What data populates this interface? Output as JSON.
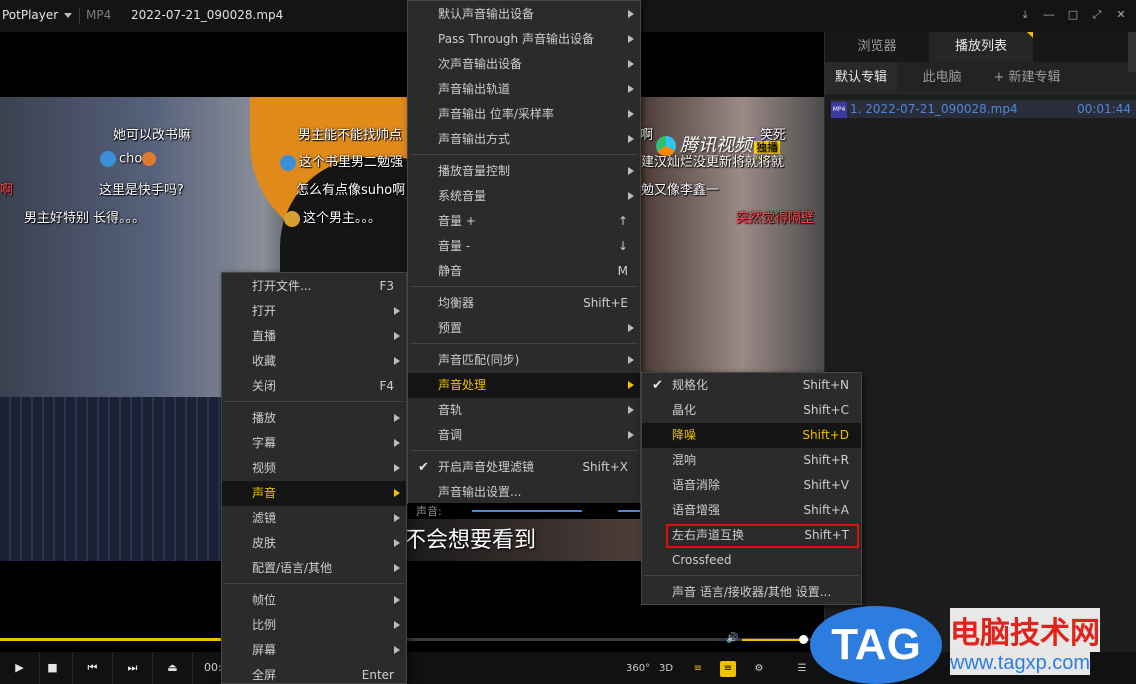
{
  "titlebar": {
    "app": "PotPlayer",
    "format": "MP4",
    "filename": "2022-07-21_090028.mp4",
    "buttons": [
      "pin-icon",
      "minimize-icon",
      "maximize-icon",
      "fullscreen-icon",
      "close-icon"
    ]
  },
  "danmaku": [
    {
      "text": "她可以改书嘛"
    },
    {
      "text": "男主能不能找帅点"
    },
    {
      "text": "cho"
    },
    {
      "text": "这个书里男二勉强"
    },
    {
      "text": "这里是快手吗?"
    },
    {
      "text": "怎么有点像suho啊"
    },
    {
      "text": "男主好特别 长得。。。"
    },
    {
      "text": "这个男主。。。"
    },
    {
      "text": "啊"
    },
    {
      "text": "笑死"
    },
    {
      "text": "建汉灿烂没更新将就将就"
    },
    {
      "text": "勉又像李鑫一"
    },
    {
      "text": "突然觉得隔壁"
    },
    {
      "text": "啊"
    }
  ],
  "video": {
    "watermark_text": "腾讯视频",
    "watermark_tag": "独播",
    "subtitle": "不会想要看到"
  },
  "panel": {
    "tabs": [
      "浏览器",
      "播放列表"
    ],
    "subtabs": [
      "默认专辑",
      "此电脑",
      "+ 新建专辑"
    ],
    "items": [
      {
        "label": "1. 2022-07-21_090028.mp4",
        "duration": "00:01:44",
        "icon": "mp4-file-icon"
      }
    ]
  },
  "controls": {
    "time": "00:",
    "icons": [
      "play-icon",
      "stop-icon",
      "prev-icon",
      "next-icon",
      "eject-icon"
    ],
    "right_icons": [
      "360-icon",
      "3d-icon",
      "playlist-search-icon",
      "subtitle-icon",
      "settings-icon",
      "menu-icon"
    ],
    "label_360": "360°",
    "label_3d": "3D",
    "volume_pct": 92,
    "seek_pct": 27
  },
  "menu1": {
    "items": [
      {
        "label": "打开文件...",
        "shortcut": "F3"
      },
      {
        "label": "打开",
        "submenu": true
      },
      {
        "label": "直播",
        "submenu": true
      },
      {
        "label": "收藏",
        "submenu": true
      },
      {
        "label": "关闭",
        "shortcut": "F4"
      },
      {
        "label": "播放",
        "submenu": true
      },
      {
        "label": "字幕",
        "submenu": true
      },
      {
        "label": "视频",
        "submenu": true
      },
      {
        "label": "声音",
        "submenu": true,
        "highlight": true
      },
      {
        "label": "滤镜",
        "submenu": true
      },
      {
        "label": "皮肤",
        "submenu": true
      },
      {
        "label": "配置/语言/其他",
        "submenu": true
      },
      {
        "label": "帧位",
        "submenu": true
      },
      {
        "label": "比例",
        "submenu": true
      },
      {
        "label": "屏幕",
        "submenu": true
      },
      {
        "label": "全屏",
        "shortcut": "Enter"
      }
    ]
  },
  "menu2": {
    "items": [
      {
        "label": "默认声音输出设备",
        "submenu": true
      },
      {
        "label": "Pass Through 声音输出设备",
        "submenu": true
      },
      {
        "label": "次声音输出设备",
        "submenu": true
      },
      {
        "label": "声音输出轨道",
        "submenu": true
      },
      {
        "label": "声音输出 位率/采样率",
        "submenu": true
      },
      {
        "label": "声音输出方式",
        "submenu": true
      },
      {
        "label": "播放音量控制",
        "submenu": true
      },
      {
        "label": "系统音量",
        "submenu": true
      },
      {
        "label": "音量 +",
        "shortcut": "↑"
      },
      {
        "label": "音量 -",
        "shortcut": "↓"
      },
      {
        "label": "静音",
        "shortcut": "M"
      },
      {
        "label": "均衡器",
        "shortcut": "Shift+E"
      },
      {
        "label": "预置",
        "submenu": true
      },
      {
        "label": "声音匹配(同步)",
        "submenu": true
      },
      {
        "label": "声音处理",
        "submenu": true,
        "highlight": true
      },
      {
        "label": "音轨",
        "submenu": true
      },
      {
        "label": "音调",
        "submenu": true
      },
      {
        "label": "开启声音处理滤镜",
        "shortcut": "Shift+X",
        "checked": true
      },
      {
        "label": "声音输出设置..."
      }
    ],
    "strip_label": "声音:"
  },
  "menu3": {
    "items": [
      {
        "label": "规格化",
        "shortcut": "Shift+N",
        "checked": true
      },
      {
        "label": "晶化",
        "shortcut": "Shift+C"
      },
      {
        "label": "降噪",
        "shortcut": "Shift+D",
        "highlight": true
      },
      {
        "label": "混响",
        "shortcut": "Shift+R"
      },
      {
        "label": "语音消除",
        "shortcut": "Shift+V"
      },
      {
        "label": "语音增强",
        "shortcut": "Shift+A"
      },
      {
        "label": "左右声道互换",
        "shortcut": "Shift+T",
        "boxed": true
      },
      {
        "label": "Crossfeed"
      },
      {
        "label": "声音 语言/接收器/其他 设置..."
      }
    ]
  },
  "watermark": {
    "tag": "TAG",
    "site_cn": "电脑技术网",
    "url": "www.tagxp.com"
  },
  "colors": {
    "accent": "#f0c000",
    "highlight_box": "#e01010",
    "playlist_text": "#4f86d6"
  }
}
